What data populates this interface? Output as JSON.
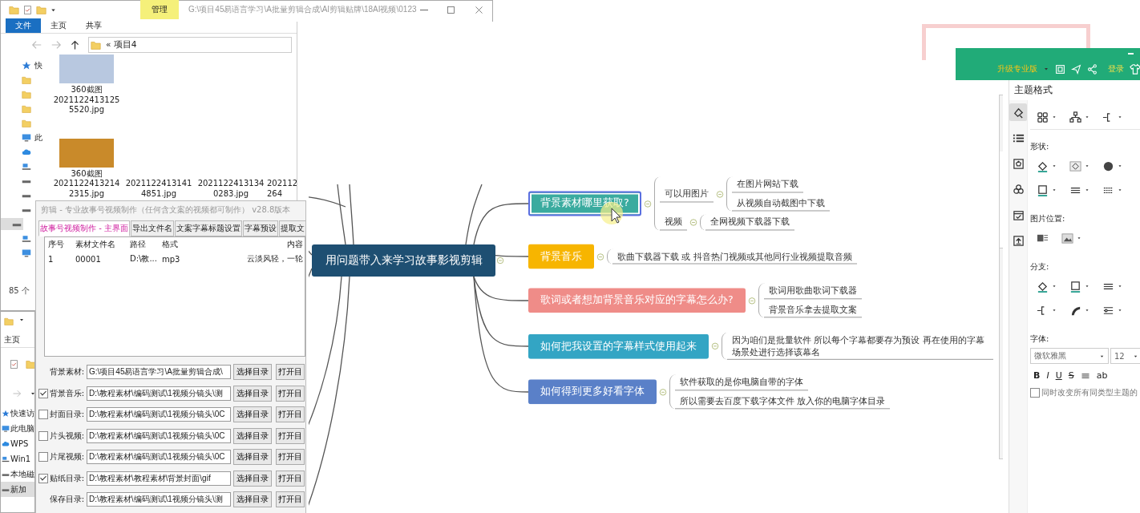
{
  "file_explorer": {
    "context_tab": "管理",
    "title": "G:\\项目45易语言学习\\A批量剪辑合成\\AI剪辑贴牌\\18AI视频\\0123",
    "ribbon_tabs": [
      {
        "label": "文件",
        "selected": true
      },
      {
        "label": "主页",
        "selected": false
      },
      {
        "label": "共享",
        "selected": false
      }
    ],
    "address": "« 项目4",
    "nav_items": [
      {
        "label": "快",
        "kind": "star"
      },
      {
        "kind": "folder"
      },
      {
        "kind": "folder"
      },
      {
        "kind": "folder"
      },
      {
        "kind": "folder"
      },
      {
        "label": "此",
        "kind": "pc"
      },
      {
        "kind": "cloud"
      },
      {
        "kind": "network"
      },
      {
        "kind": "drive"
      },
      {
        "kind": "drive"
      },
      {
        "kind": "drive"
      },
      {
        "kind": "drive",
        "selected": true
      },
      {
        "kind": "network"
      },
      {
        "kind": "pc"
      }
    ],
    "files": [
      {
        "lines": [
          "360截图",
          "2021122413125",
          "5520.jpg"
        ],
        "thumbnail": true
      },
      {
        "lines": [
          "360截图",
          "2021122413214",
          "2315.jpg"
        ],
        "thumbnail": true
      },
      {
        "lines": [
          "2021122413141",
          "4851.jpg"
        ],
        "thumbnail": false
      },
      {
        "lines": [
          "2021122413134",
          "0283.jpg"
        ],
        "thumbnail": false
      },
      {
        "lines": [
          "202112",
          "264"
        ],
        "thumbnail": false
      }
    ],
    "status": "85 个"
  },
  "back_explorer": {
    "ribbon_tab": "主页",
    "nav_items": [
      {
        "label": "快速访",
        "kind": "star"
      },
      {
        "label": "此电脑",
        "kind": "pc"
      },
      {
        "label": "WPS",
        "kind": "cloud"
      },
      {
        "label": "Win1",
        "kind": "network"
      },
      {
        "label": "本地磁",
        "kind": "drive",
        "selected": false
      },
      {
        "label": "新加",
        "kind": "drive",
        "selected": true
      }
    ]
  },
  "clip_tool": {
    "title": "剪辑 - 专业故事号视频制作（任何含文案的视频都可制作） v28.8版本",
    "tabs": [
      {
        "label": "故事号视频制作 - 主界面",
        "selected": true
      },
      {
        "label": "导出文件名",
        "selected": false
      },
      {
        "label": "文案字幕标题设置",
        "selected": false
      },
      {
        "label": "字幕预设",
        "selected": false
      },
      {
        "label": "提取文",
        "selected": false
      }
    ],
    "columns": [
      "序号",
      "素材文件名",
      "路径",
      "格式",
      "内容"
    ],
    "rows": [
      [
        "1",
        "00001",
        "D:\\教...",
        "mp3",
        "云淡风轻，一轮"
      ]
    ],
    "fields": [
      {
        "label": "背景素材:",
        "kind": "plain",
        "value": "G:\\项目45易语言学习\\A批量剪辑合成\\",
        "buttons": [
          "选择目录",
          "打开目"
        ]
      },
      {
        "label": "背景音乐:",
        "kind": "checkbox",
        "checked": true,
        "value": "D:\\教程素材\\编码测试\\1视频分镜头\\测",
        "buttons": [
          "选择目录",
          "打开目"
        ]
      },
      {
        "label": "封面目录:",
        "kind": "checkbox",
        "checked": false,
        "value": "D:\\教程素材\\编码测试\\1视频分镜头\\0C",
        "buttons": [
          "选择目录",
          "打开目"
        ]
      },
      {
        "label": "片头视频:",
        "kind": "checkbox",
        "checked": false,
        "value": "D:\\教程素材\\编码测试\\1视频分镜头\\0C",
        "buttons": [
          "选择目录",
          "打开目"
        ]
      },
      {
        "label": "片尾视频:",
        "kind": "checkbox",
        "checked": false,
        "value": "D:\\教程素材\\编码测试\\1视频分镜头\\0C",
        "buttons": [
          "选择目录",
          "打开目"
        ]
      },
      {
        "label": "贴纸目录:",
        "kind": "checkbox",
        "checked": true,
        "value": "D:\\教程素材\\教程素材\\背景封面\\gif",
        "buttons": [
          "选择目录",
          "打开目"
        ]
      },
      {
        "label": "保存目录:",
        "kind": "plain",
        "value": "D:\\教程素材\\编码测试\\1视频分镜头\\测",
        "buttons": [
          "选择目录",
          "打开目"
        ]
      }
    ]
  },
  "mind_map": {
    "root": "用问题带入来学习故事影视剪辑",
    "branches": [
      {
        "text": "背景素材哪里获取?",
        "color": "#3aab9f",
        "selected": true,
        "children": [
          {
            "text": "可以用图片",
            "children": [
              {
                "text": "在图片网站下载"
              },
              {
                "text": "从视频自动截图中下载"
              }
            ]
          },
          {
            "text": "视频",
            "children": [
              {
                "text": "全网视频下载器下载"
              }
            ]
          }
        ]
      },
      {
        "text": "背景音乐",
        "color": "#f7b500",
        "selected": false,
        "children": [
          {
            "text": "歌曲下载器下载 或 抖音热门视频或其他同行业视频提取音频"
          }
        ]
      },
      {
        "text": "歌词或者想加背景音乐对应的字幕怎么办?",
        "color": "#ef8c88",
        "selected": false,
        "children": [
          {
            "text": "歌词用歌曲歌词下载器"
          },
          {
            "text": "背景音乐拿去提取文案"
          }
        ]
      },
      {
        "text": "如何把我设置的字幕样式使用起来",
        "color": "#33a5c4",
        "selected": false,
        "children": [
          {
            "text": "因为咱们是批量软件 所以每个字幕都要存为预设 再在使用的字幕场景处进行选择该幕名"
          }
        ]
      },
      {
        "text": "如何得到更多好看字体",
        "color": "#5a80c8",
        "selected": false,
        "children": [
          {
            "text": "软件获取的是你电脑自带的字体"
          },
          {
            "text": "所以需要去百度下载字体文件 放入你的电脑字体目录"
          }
        ]
      }
    ]
  },
  "top_bar": {
    "upgrade": "升级专业版",
    "login": "登录"
  },
  "format_panel": {
    "title": "主题格式",
    "side_tabs": [
      {
        "selected": true
      },
      {
        "selected": false
      },
      {
        "selected": false
      },
      {
        "selected": false
      },
      {
        "selected": false
      },
      {
        "selected": false
      }
    ],
    "shape_label": "形状:",
    "image_position_label": "图片位置:",
    "branch_label": "分支:",
    "font_label": "字体:",
    "font_family": "微软雅黑",
    "font_size": "12",
    "text_styles": [
      "B",
      "I",
      "U",
      "S"
    ],
    "highlight": "ab",
    "apply_all": {
      "label": "同时改变所有同类型主题的",
      "checked": false
    }
  }
}
